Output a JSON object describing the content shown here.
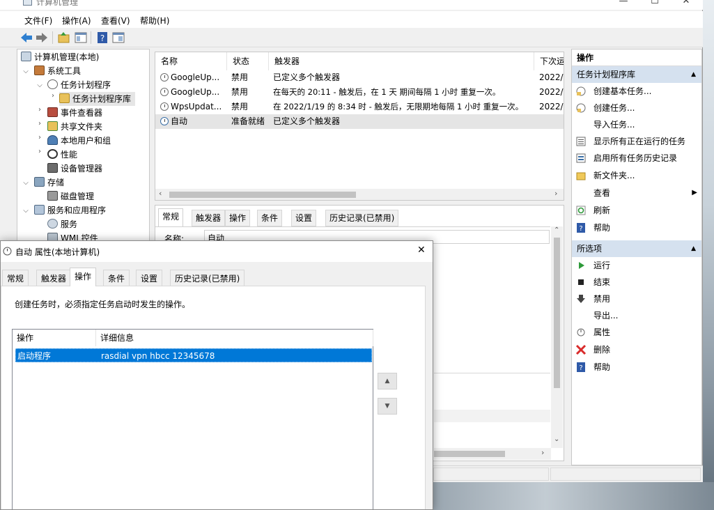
{
  "colors": {
    "selection": "#0078d7",
    "section_header": "#d5e1ef",
    "window_bg": "#f0f0f0"
  },
  "window": {
    "title": "计算机管理",
    "min": "—",
    "max": "☐",
    "close": "✕"
  },
  "menu": [
    "文件(F)",
    "操作(A)",
    "查看(V)",
    "帮助(H)"
  ],
  "toolbar": {
    "icons": [
      "back-icon",
      "forward-icon",
      "up-folder-icon",
      "show-hide-console-tree-icon",
      "help-icon",
      "properties-icon"
    ]
  },
  "tree": [
    {
      "label": "计算机管理(本地)",
      "icon": "computer-management-icon"
    },
    {
      "label": "系统工具",
      "icon": "tools-icon"
    },
    {
      "label": "任务计划程序",
      "icon": "clock-icon"
    },
    {
      "label": "任务计划程序库",
      "icon": "folder-clock-icon"
    },
    {
      "label": "事件查看器",
      "icon": "event-viewer-icon"
    },
    {
      "label": "共享文件夹",
      "icon": "shared-folder-icon"
    },
    {
      "label": "本地用户和组",
      "icon": "users-icon"
    },
    {
      "label": "性能",
      "icon": "performance-icon"
    },
    {
      "label": "设备管理器",
      "icon": "device-manager-icon"
    },
    {
      "label": "存储",
      "icon": "storage-icon"
    },
    {
      "label": "磁盘管理",
      "icon": "disk-icon"
    },
    {
      "label": "服务和应用程序",
      "icon": "services-apps-icon"
    },
    {
      "label": "服务",
      "icon": "gear-icon"
    },
    {
      "label": "WMI 控件",
      "icon": "wmi-icon"
    }
  ],
  "task_list": {
    "columns": [
      "名称",
      "状态",
      "触发器",
      "下次运"
    ],
    "rows": [
      {
        "name": "GoogleUp...",
        "status": "禁用",
        "trigger": "已定义多个触发器",
        "next": "2022/"
      },
      {
        "name": "GoogleUp...",
        "status": "禁用",
        "trigger": "在每天的 20:11 - 触发后，在 1 天 期间每隔 1 小时 重复一次。",
        "next": "2022/"
      },
      {
        "name": "WpsUpdat...",
        "status": "禁用",
        "trigger": "在 2022/1/19 的 8:34 时 - 触发后，无限期地每隔 1 小时 重复一次。",
        "next": "2022/"
      },
      {
        "name": "自动",
        "status": "准备就绪",
        "trigger": "已定义多个触发器",
        "next": ""
      }
    ]
  },
  "detail": {
    "tabs": [
      "常规",
      "触发器",
      "操作",
      "条件",
      "设置",
      "历史记录(已禁用)"
    ],
    "name_label": "名称:",
    "name_value": "自动"
  },
  "actions": {
    "title": "操作",
    "section1": {
      "title": "任务计划程序库",
      "items": [
        {
          "label": "创建基本任务...",
          "icon": "create-basic-task-icon"
        },
        {
          "label": "创建任务...",
          "icon": "create-task-icon"
        },
        {
          "label": "导入任务...",
          "icon": ""
        },
        {
          "label": "显示所有正在运行的任务",
          "icon": "running-tasks-icon"
        },
        {
          "label": "启用所有任务历史记录",
          "icon": "history-icon"
        },
        {
          "label": "新文件夹...",
          "icon": "new-folder-icon"
        },
        {
          "label": "查看",
          "icon": ""
        },
        {
          "label": "刷新",
          "icon": "refresh-icon"
        },
        {
          "label": "帮助",
          "icon": "help-icon"
        }
      ]
    },
    "section2": {
      "title": "所选项",
      "items": [
        {
          "label": "运行",
          "icon": "run-icon"
        },
        {
          "label": "结束",
          "icon": "stop-icon"
        },
        {
          "label": "禁用",
          "icon": "disable-icon"
        },
        {
          "label": "导出...",
          "icon": ""
        },
        {
          "label": "属性",
          "icon": "properties-icon"
        },
        {
          "label": "删除",
          "icon": "delete-icon"
        },
        {
          "label": "帮助",
          "icon": "help-icon"
        }
      ]
    }
  },
  "dialog": {
    "title": "自动 属性(本地计算机)",
    "close": "✕",
    "tabs": [
      "常规",
      "触发器",
      "操作",
      "条件",
      "设置",
      "历史记录(已禁用)"
    ],
    "active_tab": "操作",
    "description": "创建任务时，必须指定任务启动时发生的操作。",
    "table": {
      "columns": [
        "操作",
        "详细信息"
      ],
      "rows": [
        {
          "action": "启动程序",
          "detail": "rasdial vpn hbcc 12345678"
        }
      ]
    }
  }
}
